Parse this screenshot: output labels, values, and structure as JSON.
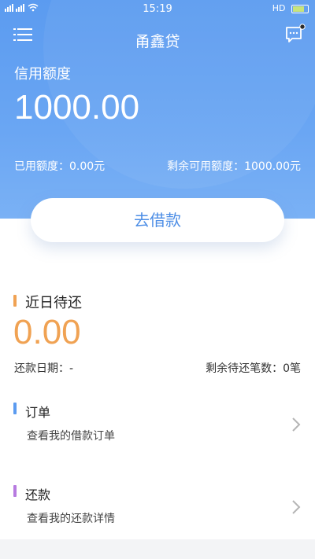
{
  "status_bar": {
    "signal": "..l..l",
    "time": "15:19",
    "right_text": "HD"
  },
  "header": {
    "title": "甬鑫贷"
  },
  "credit": {
    "label": "信用额度",
    "value": "1000.00",
    "used": "已用额度：0.00元",
    "remaining": "剩余可用额度：1000.00元"
  },
  "borrow_button": {
    "label": "去借款"
  },
  "recent": {
    "title": "近日待还",
    "amount": "0.00",
    "repay_date": "还款日期：-",
    "remaining_count": "剩余待还笔数：0笔"
  },
  "orders": {
    "title": "订单",
    "subtitle": "查看我的借款订单"
  },
  "repayment": {
    "title": "还款",
    "subtitle": "查看我的还款详情"
  },
  "colors": {
    "header_blue": "#5b9bf0",
    "amount_orange": "#f0a253",
    "bar_orange": "#f0a253",
    "bar_blue": "#5b9bf0",
    "bar_purple": "#b77be0"
  },
  "icons": [
    "menu-icon",
    "message-icon",
    "wifi-icon",
    "battery-icon",
    "chevron-right-icon"
  ]
}
